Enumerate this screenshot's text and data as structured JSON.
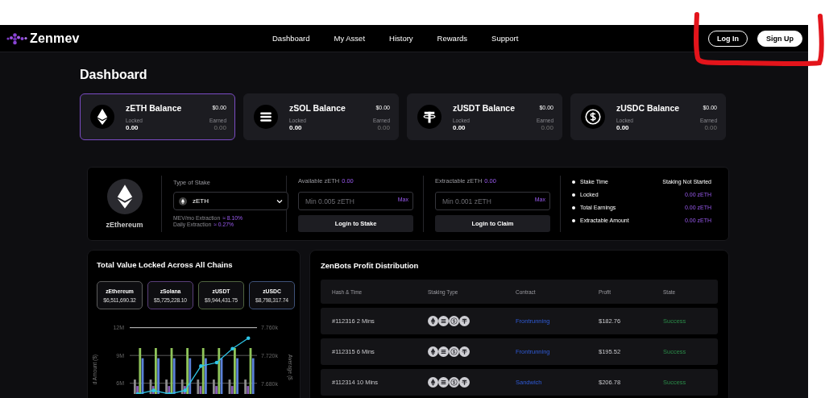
{
  "nav": {
    "brand": "Zenmev",
    "links": [
      {
        "label": "Dashboard"
      },
      {
        "label": "My Asset"
      },
      {
        "label": "History"
      },
      {
        "label": "Rewards"
      },
      {
        "label": "Support"
      }
    ],
    "buttons": [
      {
        "label": "Log In",
        "kind": "outline"
      },
      {
        "label": "Sign Up",
        "kind": "solid"
      }
    ]
  },
  "page_title": "Dashboard",
  "balances": [
    {
      "title": "zETH Balance",
      "usd": "$0.00",
      "locked_label": "Locked",
      "locked": "0.00",
      "earned_label": "Earned",
      "earned": "0.00",
      "selected": true
    },
    {
      "title": "zSOL Balance",
      "usd": "$0.00",
      "locked_label": "Locked",
      "locked": "0.00",
      "earned_label": "Earned",
      "earned": "0.00",
      "selected": false
    },
    {
      "title": "zUSDT Balance",
      "usd": "$0.00",
      "locked_label": "Locked",
      "locked": "0.00",
      "earned_label": "Earned",
      "earned": "0.00",
      "selected": false
    },
    {
      "title": "zUSDC Balance",
      "usd": "$0.00",
      "locked_label": "Locked",
      "locked": "0.00",
      "earned_label": "Earned",
      "earned": "0.00",
      "selected": false
    }
  ],
  "stake": {
    "asset": {
      "name": "zEthereum"
    },
    "type_label": "Type of Stake",
    "type_value": "zETH",
    "extraction": [
      {
        "label": "MEV/mo Extraction",
        "value": "≈ 8.10%"
      },
      {
        "label": "Daily Extraction",
        "value": "≈ 0.27%"
      }
    ],
    "forms": [
      {
        "label": "Available zETH",
        "amount": "0.00",
        "placeholder": "Min 0.005 zETH",
        "max": "Max",
        "button": "Login to Stake"
      },
      {
        "label": "Extractable zETH",
        "amount": "0.00",
        "placeholder": "Min 0.001 zETH",
        "max": "Max",
        "button": "Login to Claim"
      }
    ],
    "stats": [
      {
        "label": "Stake Time",
        "value": "Staking Not Started",
        "highlight": false
      },
      {
        "label": "Locked",
        "value": "0.00 zETH",
        "highlight": true
      },
      {
        "label": "Total Earnings",
        "value": "0.00 zETH",
        "highlight": true
      },
      {
        "label": "Extractable Amount",
        "value": "0.00 zETH",
        "highlight": true
      }
    ]
  },
  "tvl": {
    "title": "Total Value Locked Across All Chains",
    "chains": [
      {
        "name": "zEthereum",
        "value": "$6,511,690.32",
        "color": "#5c5c5c"
      },
      {
        "name": "zSolana",
        "value": "$5,725,228.10",
        "color": "#5a3f7a"
      },
      {
        "name": "zUSDT",
        "value": "$9,944,431.75",
        "color": "#4f6340"
      },
      {
        "name": "zUSDC",
        "value": "$8,798,317.74",
        "color": "#3f5278"
      }
    ],
    "chart_data": {
      "type": "bar",
      "ylabel": "d Amount ($)",
      "y2label": "Average ($",
      "ylim": [
        4840000,
        12000000
      ],
      "y2lim": [
        7665,
        7760
      ],
      "yticks": [
        {
          "value": 6000000,
          "label": "6M"
        },
        {
          "value": 9000000,
          "label": "9M"
        },
        {
          "value": 12000000,
          "label": "12M"
        }
      ],
      "y2ticks": [
        {
          "value": 7680,
          "label": "7.680k"
        },
        {
          "value": 7720,
          "label": "7.720k"
        },
        {
          "value": 7760,
          "label": "7.760k"
        }
      ],
      "series": [
        {
          "color": "#8c8c8c",
          "values": [
            6400000,
            6400000,
            6400000,
            6400000,
            6400000,
            6400000,
            6400000,
            6400000
          ]
        },
        {
          "color": "#8a5bb8",
          "values": [
            5700000,
            5700000,
            5700000,
            5700000,
            5700000,
            5700000,
            5700000,
            5700000
          ]
        },
        {
          "color": "#8fc45a",
          "values": [
            9800000,
            9800000,
            9800000,
            9800000,
            9800000,
            9800000,
            9800000,
            9800000
          ]
        },
        {
          "color": "#5b80d8",
          "values": [
            8700000,
            8700000,
            8700000,
            8700000,
            8700000,
            8700000,
            8700000,
            8700000
          ]
        },
        {
          "type": "line",
          "axis": "y2",
          "color": "#2ec4e6",
          "values": [
            7665,
            7670,
            7665,
            7670,
            7705,
            7710,
            7730,
            7745
          ]
        }
      ]
    }
  },
  "profits": {
    "title": "ZenBots Profit Distribution",
    "columns": [
      "Hash & Time",
      "Staking Type",
      "Contract",
      "Profit",
      "State"
    ],
    "rows": [
      {
        "hash_time": "#112316 2 Mins",
        "contract": "Frontrunning",
        "profit": "$182.76",
        "state": "Success"
      },
      {
        "hash_time": "#112315 6 Mins",
        "contract": "Frontrunning",
        "profit": "$195.52",
        "state": "Success"
      },
      {
        "hash_time": "#112314 10 Mins",
        "contract": "Sandwich",
        "profit": "$206.78",
        "state": "Success"
      }
    ]
  }
}
